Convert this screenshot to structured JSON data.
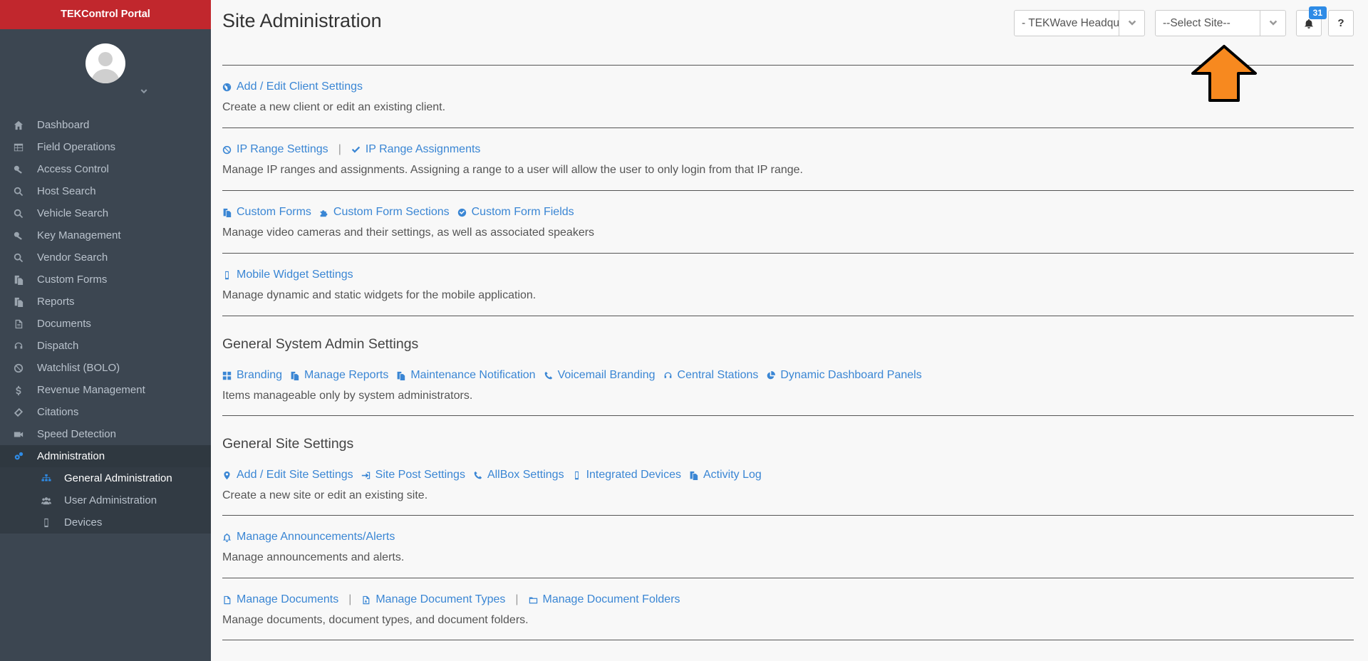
{
  "app": {
    "brand": "TEKControl Portal"
  },
  "sidebar": {
    "items": [
      {
        "label": "Dashboard",
        "icon": "home-icon"
      },
      {
        "label": "Field Operations",
        "icon": "table-icon"
      },
      {
        "label": "Access Control",
        "icon": "key-icon"
      },
      {
        "label": "Host Search",
        "icon": "search-icon"
      },
      {
        "label": "Vehicle Search",
        "icon": "search-icon"
      },
      {
        "label": "Key Management",
        "icon": "key-icon"
      },
      {
        "label": "Vendor Search",
        "icon": "search-icon"
      },
      {
        "label": "Custom Forms",
        "icon": "copy-icon"
      },
      {
        "label": "Reports",
        "icon": "copy-icon"
      },
      {
        "label": "Documents",
        "icon": "file-icon"
      },
      {
        "label": "Dispatch",
        "icon": "headset-icon"
      },
      {
        "label": "Watchlist (BOLO)",
        "icon": "ban-icon"
      },
      {
        "label": "Revenue Management",
        "icon": "dollar-icon"
      },
      {
        "label": "Citations",
        "icon": "ticket-icon"
      },
      {
        "label": "Speed Detection",
        "icon": "video-icon"
      },
      {
        "label": "Administration",
        "icon": "cogs-icon"
      }
    ],
    "subitems": [
      {
        "label": "General Administration",
        "icon": "sitemap-icon"
      },
      {
        "label": "User Administration",
        "icon": "users-icon"
      },
      {
        "label": "Devices",
        "icon": "mobile-icon"
      }
    ]
  },
  "header": {
    "title": "Site Administration",
    "client_select": "- TEKWave Headqu",
    "site_select": "--Select Site--",
    "notification_count": "31",
    "help_label": "?"
  },
  "sections": {
    "client": {
      "links": [
        "Add / Edit Client Settings"
      ],
      "desc": "Create a new client or edit an existing client."
    },
    "ip": {
      "links": [
        "IP Range Settings",
        "IP Range Assignments"
      ],
      "separator": "|",
      "desc": "Manage IP ranges and assignments. Assigning a range to a user will allow the user to only login from that IP range."
    },
    "forms": {
      "links": [
        "Custom Forms",
        "Custom Form Sections",
        "Custom Form Fields"
      ],
      "desc": "Manage video cameras and their settings, as well as associated speakers"
    },
    "mobile": {
      "links": [
        "Mobile Widget Settings"
      ],
      "desc": "Manage dynamic and static widgets for the mobile application."
    },
    "system": {
      "title": "General System Admin Settings",
      "links": [
        "Branding",
        "Manage Reports",
        "Maintenance Notification",
        "Voicemail Branding",
        "Central Stations",
        "Dynamic Dashboard Panels"
      ],
      "desc": "Items manageable only by system administrators."
    },
    "site": {
      "title": "General Site Settings",
      "links": [
        "Add / Edit Site Settings",
        "Site Post Settings",
        "AllBox Settings",
        "Integrated Devices",
        "Activity Log"
      ],
      "desc": "Create a new site or edit an existing site."
    },
    "announce": {
      "links": [
        "Manage Announcements/Alerts"
      ],
      "desc": "Manage announcements and alerts."
    },
    "docs": {
      "links": [
        "Manage Documents",
        "Manage Document Types",
        "Manage Document Folders"
      ],
      "separator": "|",
      "desc": "Manage documents, document types, and document folders."
    }
  },
  "colors": {
    "brand": "#c1272d",
    "sidebar": "#3c4651",
    "link": "#3a86d4",
    "accent": "#2e8be6",
    "arrow": "#f7891f"
  }
}
